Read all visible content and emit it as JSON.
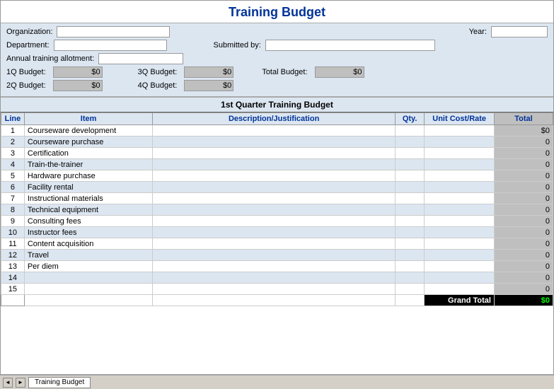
{
  "title": "Training Budget",
  "form": {
    "org_label": "Organization:",
    "org_value": "",
    "year_label": "Year:",
    "year_value": "",
    "dept_label": "Department:",
    "dept_value": "",
    "submitted_label": "Submitted by:",
    "submitted_value": "",
    "allotment_label": "Annual training allotment:",
    "allotment_value": "",
    "q1_label": "1Q Budget:",
    "q1_value": "$0",
    "q2_label": "2Q Budget:",
    "q2_value": "$0",
    "q3_label": "3Q Budget:",
    "q3_value": "$0",
    "q4_label": "4Q Budget:",
    "q4_value": "$0",
    "total_label": "Total Budget:",
    "total_value": "$0"
  },
  "section_header": "1st Quarter Training Budget",
  "table": {
    "col_line": "Line",
    "col_item": "Item",
    "col_desc": "Description/Justification",
    "col_qty": "Qty.",
    "col_unit": "Unit Cost/Rate",
    "col_total": "Total",
    "rows": [
      {
        "line": "1",
        "item": "Courseware development",
        "desc": "",
        "qty": "",
        "unit": "",
        "total": "$0"
      },
      {
        "line": "2",
        "item": "Courseware purchase",
        "desc": "",
        "qty": "",
        "unit": "",
        "total": "0"
      },
      {
        "line": "3",
        "item": "Certification",
        "desc": "",
        "qty": "",
        "unit": "",
        "total": "0"
      },
      {
        "line": "4",
        "item": "Train-the-trainer",
        "desc": "",
        "qty": "",
        "unit": "",
        "total": "0"
      },
      {
        "line": "5",
        "item": "Hardware purchase",
        "desc": "",
        "qty": "",
        "unit": "",
        "total": "0"
      },
      {
        "line": "6",
        "item": "Facility rental",
        "desc": "",
        "qty": "",
        "unit": "",
        "total": "0"
      },
      {
        "line": "7",
        "item": "Instructional materials",
        "desc": "",
        "qty": "",
        "unit": "",
        "total": "0"
      },
      {
        "line": "8",
        "item": "Technical equipment",
        "desc": "",
        "qty": "",
        "unit": "",
        "total": "0"
      },
      {
        "line": "9",
        "item": "Consulting fees",
        "desc": "",
        "qty": "",
        "unit": "",
        "total": "0"
      },
      {
        "line": "10",
        "item": "Instructor fees",
        "desc": "",
        "qty": "",
        "unit": "",
        "total": "0"
      },
      {
        "line": "11",
        "item": "Content acquisition",
        "desc": "",
        "qty": "",
        "unit": "",
        "total": "0"
      },
      {
        "line": "12",
        "item": "Travel",
        "desc": "",
        "qty": "",
        "unit": "",
        "total": "0"
      },
      {
        "line": "13",
        "item": "Per diem",
        "desc": "",
        "qty": "",
        "unit": "",
        "total": "0"
      },
      {
        "line": "14",
        "item": "",
        "desc": "",
        "qty": "",
        "unit": "",
        "total": "0"
      },
      {
        "line": "15",
        "item": "",
        "desc": "",
        "qty": "",
        "unit": "",
        "total": "0"
      }
    ],
    "grand_total_label": "Grand Total",
    "grand_total_value": "$0"
  },
  "taskbar": {
    "tab_label": "Training Budget"
  }
}
